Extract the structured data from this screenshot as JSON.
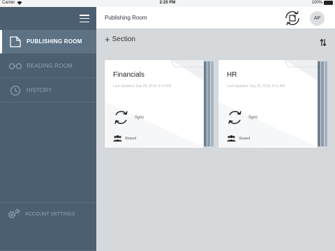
{
  "status_bar": {
    "carrier": "Carrier",
    "time": "2:20 PM",
    "battery": "100%"
  },
  "header": {
    "title": "Publishing Room",
    "avatar_initials": "AP"
  },
  "sidebar": {
    "items": [
      {
        "label": "PUBLISHING ROOM",
        "icon": "document-icon",
        "active": true
      },
      {
        "label": "READING ROOM",
        "icon": "glasses-icon",
        "active": false
      },
      {
        "label": "HISTORY",
        "icon": "clock-icon",
        "active": false
      }
    ],
    "account_label": "ACCOUNT SETTINGS"
  },
  "main": {
    "add_section_label": "Section",
    "cards": [
      {
        "name": "Financials",
        "updated": "Last Updated: Sep 28, 2015, 8:12 AM",
        "sync_label": "Sync",
        "shared_label": "Shared"
      },
      {
        "name": "HR",
        "updated": "Last Updated: Sep 28, 2015, 8:11 AM",
        "sync_label": "Sync",
        "shared_label": "Shared"
      }
    ]
  },
  "colors": {
    "sidebar": "#4c5f71",
    "sidebar_active": "#5d7285",
    "content_bg": "#d6d9dc",
    "spine": "#6d8193"
  }
}
